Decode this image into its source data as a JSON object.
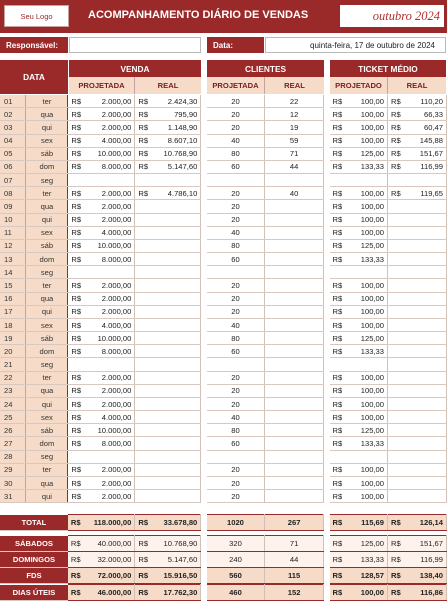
{
  "header": {
    "logo": "Seu Logo",
    "title": "ACOMPANHAMENTO DIÁRIO DE VENDAS",
    "month": "outubro 2024"
  },
  "info": {
    "responsavel_label": "Responsável:",
    "responsavel_value": "",
    "data_label": "Data:",
    "data_value": "quinta-feira, 17 de outubro de 2024"
  },
  "columns": {
    "data": "DATA",
    "venda": "VENDA",
    "clientes": "CLIENTES",
    "ticket": "TICKET MÉDIO",
    "projetada": "PROJETADA",
    "real": "REAL",
    "projetado": "PROJETADO",
    "currency": "R$"
  },
  "rows": [
    {
      "d": "01",
      "w": "ter",
      "vp": "2.000,00",
      "vr": "2.424,30",
      "cp": "20",
      "cr": "22",
      "tp": "100,00",
      "tr": "110,20"
    },
    {
      "d": "02",
      "w": "qua",
      "vp": "2.000,00",
      "vr": "795,90",
      "cp": "20",
      "cr": "12",
      "tp": "100,00",
      "tr": "66,33"
    },
    {
      "d": "03",
      "w": "qui",
      "vp": "2.000,00",
      "vr": "1.148,90",
      "cp": "20",
      "cr": "19",
      "tp": "100,00",
      "tr": "60,47"
    },
    {
      "d": "04",
      "w": "sex",
      "vp": "4.000,00",
      "vr": "8.607,10",
      "cp": "40",
      "cr": "59",
      "tp": "100,00",
      "tr": "145,88"
    },
    {
      "d": "05",
      "w": "sáb",
      "vp": "10.000,00",
      "vr": "10.768,90",
      "cp": "80",
      "cr": "71",
      "tp": "125,00",
      "tr": "151,67"
    },
    {
      "d": "06",
      "w": "dom",
      "vp": "8.000,00",
      "vr": "5.147,60",
      "cp": "60",
      "cr": "44",
      "tp": "133,33",
      "tr": "116,99"
    },
    {
      "d": "07",
      "w": "seg",
      "vp": "",
      "vr": "",
      "cp": "",
      "cr": "",
      "tp": "",
      "tr": ""
    },
    {
      "d": "08",
      "w": "ter",
      "vp": "2.000,00",
      "vr": "4.786,10",
      "cp": "20",
      "cr": "40",
      "tp": "100,00",
      "tr": "119,65"
    },
    {
      "d": "09",
      "w": "qua",
      "vp": "2.000,00",
      "vr": "",
      "cp": "20",
      "cr": "",
      "tp": "100,00",
      "tr": ""
    },
    {
      "d": "10",
      "w": "qui",
      "vp": "2.000,00",
      "vr": "",
      "cp": "20",
      "cr": "",
      "tp": "100,00",
      "tr": ""
    },
    {
      "d": "11",
      "w": "sex",
      "vp": "4.000,00",
      "vr": "",
      "cp": "40",
      "cr": "",
      "tp": "100,00",
      "tr": ""
    },
    {
      "d": "12",
      "w": "sáb",
      "vp": "10.000,00",
      "vr": "",
      "cp": "80",
      "cr": "",
      "tp": "125,00",
      "tr": ""
    },
    {
      "d": "13",
      "w": "dom",
      "vp": "8.000,00",
      "vr": "",
      "cp": "60",
      "cr": "",
      "tp": "133,33",
      "tr": ""
    },
    {
      "d": "14",
      "w": "seg",
      "vp": "",
      "vr": "",
      "cp": "",
      "cr": "",
      "tp": "",
      "tr": ""
    },
    {
      "d": "15",
      "w": "ter",
      "vp": "2.000,00",
      "vr": "",
      "cp": "20",
      "cr": "",
      "tp": "100,00",
      "tr": ""
    },
    {
      "d": "16",
      "w": "qua",
      "vp": "2.000,00",
      "vr": "",
      "cp": "20",
      "cr": "",
      "tp": "100,00",
      "tr": ""
    },
    {
      "d": "17",
      "w": "qui",
      "vp": "2.000,00",
      "vr": "",
      "cp": "20",
      "cr": "",
      "tp": "100,00",
      "tr": ""
    },
    {
      "d": "18",
      "w": "sex",
      "vp": "4.000,00",
      "vr": "",
      "cp": "40",
      "cr": "",
      "tp": "100,00",
      "tr": ""
    },
    {
      "d": "19",
      "w": "sáb",
      "vp": "10.000,00",
      "vr": "",
      "cp": "80",
      "cr": "",
      "tp": "125,00",
      "tr": ""
    },
    {
      "d": "20",
      "w": "dom",
      "vp": "8.000,00",
      "vr": "",
      "cp": "60",
      "cr": "",
      "tp": "133,33",
      "tr": ""
    },
    {
      "d": "21",
      "w": "seg",
      "vp": "",
      "vr": "",
      "cp": "",
      "cr": "",
      "tp": "",
      "tr": ""
    },
    {
      "d": "22",
      "w": "ter",
      "vp": "2.000,00",
      "vr": "",
      "cp": "20",
      "cr": "",
      "tp": "100,00",
      "tr": ""
    },
    {
      "d": "23",
      "w": "qua",
      "vp": "2.000,00",
      "vr": "",
      "cp": "20",
      "cr": "",
      "tp": "100,00",
      "tr": ""
    },
    {
      "d": "24",
      "w": "qui",
      "vp": "2.000,00",
      "vr": "",
      "cp": "20",
      "cr": "",
      "tp": "100,00",
      "tr": ""
    },
    {
      "d": "25",
      "w": "sex",
      "vp": "4.000,00",
      "vr": "",
      "cp": "40",
      "cr": "",
      "tp": "100,00",
      "tr": ""
    },
    {
      "d": "26",
      "w": "sáb",
      "vp": "10.000,00",
      "vr": "",
      "cp": "80",
      "cr": "",
      "tp": "125,00",
      "tr": ""
    },
    {
      "d": "27",
      "w": "dom",
      "vp": "8.000,00",
      "vr": "",
      "cp": "60",
      "cr": "",
      "tp": "133,33",
      "tr": ""
    },
    {
      "d": "28",
      "w": "seg",
      "vp": "",
      "vr": "",
      "cp": "",
      "cr": "",
      "tp": "",
      "tr": ""
    },
    {
      "d": "29",
      "w": "ter",
      "vp": "2.000,00",
      "vr": "",
      "cp": "20",
      "cr": "",
      "tp": "100,00",
      "tr": ""
    },
    {
      "d": "30",
      "w": "qua",
      "vp": "2.000,00",
      "vr": "",
      "cp": "20",
      "cr": "",
      "tp": "100,00",
      "tr": ""
    },
    {
      "d": "31",
      "w": "qui",
      "vp": "2.000,00",
      "vr": "",
      "cp": "20",
      "cr": "",
      "tp": "100,00",
      "tr": ""
    }
  ],
  "total": {
    "label": "TOTAL",
    "vp": "118.000,00",
    "vr": "33.678,80",
    "cp": "1020",
    "cr": "267",
    "tp": "115,69",
    "tr": "126,14"
  },
  "summary": [
    {
      "label": "SÁBADOS",
      "vp": "40.000,00",
      "vr": "10.768,90",
      "cp": "320",
      "cr": "71",
      "tp": "125,00",
      "tr": "151,67",
      "bold": false
    },
    {
      "label": "DOMINGOS",
      "vp": "32.000,00",
      "vr": "5.147,60",
      "cp": "240",
      "cr": "44",
      "tp": "133,33",
      "tr": "116,99",
      "bold": false
    },
    {
      "label": "FDS",
      "vp": "72.000,00",
      "vr": "15.916,50",
      "cp": "560",
      "cr": "115",
      "tp": "128,57",
      "tr": "138,40",
      "bold": true
    }
  ],
  "dias_uteis": {
    "label": "DIAS ÚTEIS",
    "vp": "46.000,00",
    "vr": "17.762,30",
    "cp": "460",
    "cr": "152",
    "tp": "100,00",
    "tr": "116,86"
  },
  "colors": {
    "accent": "#9a2a2a",
    "header_fill": "#f6dcc8",
    "month_text": "#b03030"
  }
}
